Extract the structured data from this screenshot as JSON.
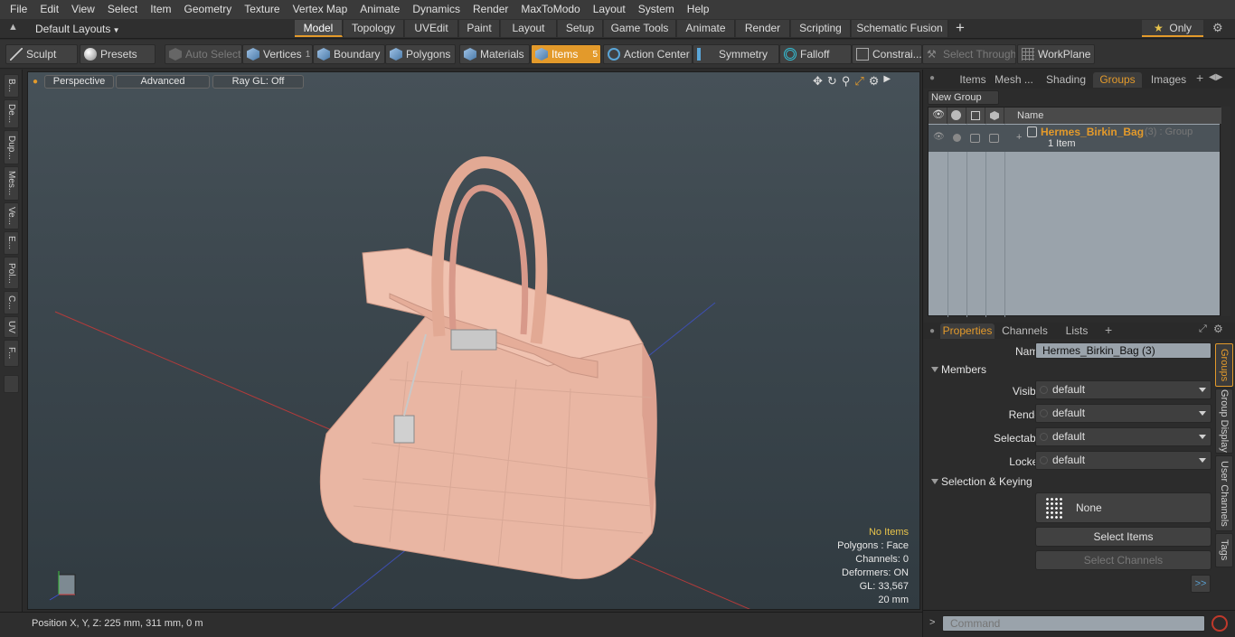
{
  "menu": [
    "File",
    "Edit",
    "View",
    "Select",
    "Item",
    "Geometry",
    "Texture",
    "Vertex Map",
    "Animate",
    "Dynamics",
    "Render",
    "MaxToModo",
    "Layout",
    "System",
    "Help"
  ],
  "layout": {
    "selector": "Default Layouts",
    "tabs": [
      "Model",
      "Topology",
      "UVEdit",
      "Paint",
      "Layout",
      "Setup",
      "Game Tools",
      "Animate",
      "Render",
      "Scripting",
      "Schematic Fusion"
    ],
    "add": "+",
    "only": "Only"
  },
  "toolbar": {
    "sculpt": "Sculpt",
    "presets": "Presets",
    "auto_select": "Auto Select",
    "vertices": "Vertices",
    "vertices_count": "1",
    "boundary": "Boundary",
    "polygons": "Polygons",
    "materials": "Materials",
    "items": "Items",
    "items_count": "5",
    "action_center": "Action Center",
    "symmetry": "Symmetry",
    "falloff": "Falloff",
    "constraints": "Constrai...",
    "select_through": "Select Through",
    "workplane": "WorkPlane"
  },
  "left_tabs": [
    "B...",
    "De...",
    "Dup...",
    "Mes...",
    "Ve...",
    "E...",
    "Pol...",
    "C...",
    "UV",
    "F..."
  ],
  "viewport": {
    "perspective": "Perspective",
    "advanced": "Advanced",
    "raygl": "Ray GL: Off",
    "hud": {
      "no_items": "No Items",
      "polygons": "Polygons : Face",
      "channels": "Channels: 0",
      "deformers": "Deformers: ON",
      "gl": "GL: 33,567",
      "scale": "20 mm"
    }
  },
  "status": {
    "position": "Position X, Y, Z:   225 mm, 311 mm, 0 m"
  },
  "groups_panel": {
    "tabs": [
      "Items",
      "Mesh ...",
      "Shading",
      "Groups",
      "Images"
    ],
    "active_tab": "Groups",
    "new_group": "New Group",
    "name_col": "Name",
    "group_name": "Hermes_Birkin_Bag",
    "group_suffix": "(3) : Group",
    "group_items": "1 Item"
  },
  "properties": {
    "tabs": [
      "Properties",
      "Channels",
      "Lists"
    ],
    "name_label": "Name",
    "name_value": "Hermes_Birkin_Bag (3)",
    "members": "Members",
    "visible_label": "Visible",
    "visible_value": "default",
    "render_label": "Render",
    "render_value": "default",
    "selectable_label": "Selectable",
    "selectable_value": "default",
    "locked_label": "Locked",
    "locked_value": "default",
    "sel_keying": "Selection & Keying",
    "none": "None",
    "select_items": "Select Items",
    "select_channels": "Select Channels",
    "more": ">>",
    "side_tabs": [
      "Groups",
      "Group Display",
      "User Channels",
      "Tags"
    ]
  },
  "command": {
    "prompt": ">",
    "placeholder": "Command"
  },
  "colors": {
    "accent": "#e39a2b",
    "bag": "#e9b6a3"
  }
}
